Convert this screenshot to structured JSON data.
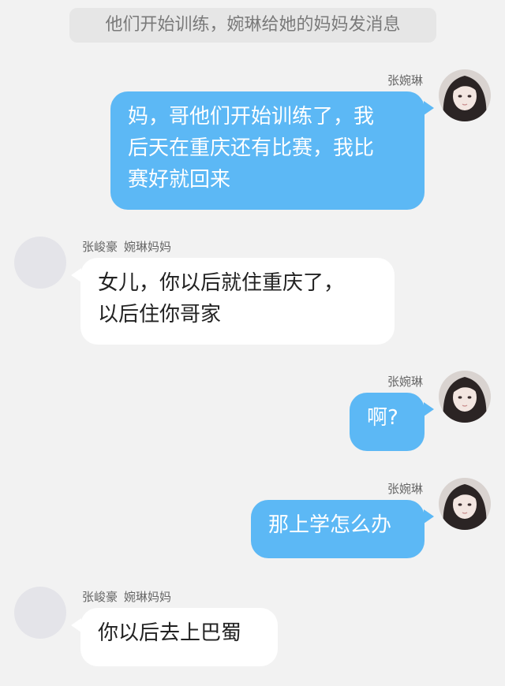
{
  "notice": "他们开始训练，婉琳给她的妈妈发消息",
  "messages": [
    {
      "side": "right",
      "sender": "张婉琳",
      "lines": [
        "妈，哥他们开始训练了，我",
        "后天在重庆还有比赛，我比",
        "赛好就回来"
      ]
    },
    {
      "side": "left",
      "sender": "张峻豪",
      "sender_tag": "婉琳妈妈",
      "lines": [
        "女儿，你以后就住重庆了，",
        "以后住你哥家"
      ]
    },
    {
      "side": "right",
      "sender": "张婉琳",
      "lines": [
        "啊?"
      ]
    },
    {
      "side": "right",
      "sender": "张婉琳",
      "lines": [
        "那上学怎么办"
      ]
    },
    {
      "side": "left",
      "sender": "张峻豪",
      "sender_tag": "婉琳妈妈",
      "lines": [
        "你以后去上巴蜀"
      ]
    }
  ],
  "colors": {
    "background": "#f2f2f2",
    "outgoing_bubble": "#5cb8f5",
    "incoming_bubble": "#ffffff"
  },
  "icons": {
    "outgoing_avatar": "girl-portrait-avatar",
    "incoming_avatar": "blank-avatar"
  }
}
